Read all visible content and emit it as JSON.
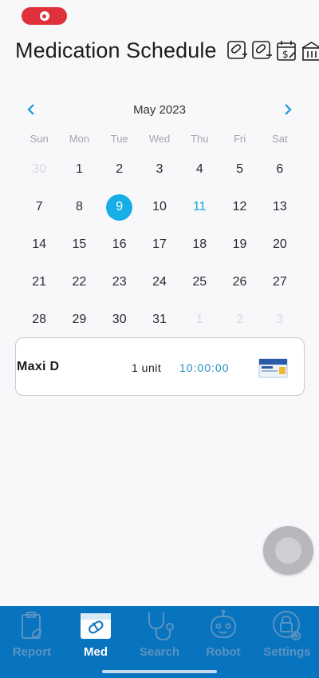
{
  "header": {
    "title": "Medication Schedule",
    "icons": [
      "add-medication-icon",
      "remove-medication-icon",
      "billing-calendar-icon",
      "pharmacy-icon"
    ]
  },
  "calendar": {
    "month_label": "May 2023",
    "weekdays": [
      "Sun",
      "Mon",
      "Tue",
      "Wed",
      "Thu",
      "Fri",
      "Sat"
    ],
    "days": [
      {
        "label": "30",
        "state": "muted"
      },
      {
        "label": "1",
        "state": ""
      },
      {
        "label": "2",
        "state": ""
      },
      {
        "label": "3",
        "state": ""
      },
      {
        "label": "4",
        "state": ""
      },
      {
        "label": "5",
        "state": ""
      },
      {
        "label": "6",
        "state": ""
      },
      {
        "label": "7",
        "state": ""
      },
      {
        "label": "8",
        "state": ""
      },
      {
        "label": "9",
        "state": "selected"
      },
      {
        "label": "10",
        "state": ""
      },
      {
        "label": "11",
        "state": "today"
      },
      {
        "label": "12",
        "state": ""
      },
      {
        "label": "13",
        "state": ""
      },
      {
        "label": "14",
        "state": ""
      },
      {
        "label": "15",
        "state": ""
      },
      {
        "label": "16",
        "state": ""
      },
      {
        "label": "17",
        "state": ""
      },
      {
        "label": "18",
        "state": ""
      },
      {
        "label": "19",
        "state": ""
      },
      {
        "label": "20",
        "state": ""
      },
      {
        "label": "21",
        "state": ""
      },
      {
        "label": "22",
        "state": ""
      },
      {
        "label": "23",
        "state": ""
      },
      {
        "label": "24",
        "state": ""
      },
      {
        "label": "25",
        "state": ""
      },
      {
        "label": "26",
        "state": ""
      },
      {
        "label": "27",
        "state": ""
      },
      {
        "label": "28",
        "state": ""
      },
      {
        "label": "29",
        "state": ""
      },
      {
        "label": "30",
        "state": ""
      },
      {
        "label": "31",
        "state": ""
      },
      {
        "label": "1",
        "state": "muted"
      },
      {
        "label": "2",
        "state": "muted"
      },
      {
        "label": "3",
        "state": "muted"
      }
    ],
    "selected_color": "#17aee8",
    "today_color": "#16a6dd"
  },
  "medications": [
    {
      "name": "Maxi D",
      "dose": "1 unit",
      "time": "10:00:00"
    }
  ],
  "bottom_nav": {
    "tabs": [
      {
        "label": "Report",
        "icon": "report-clipboard-icon",
        "active": false
      },
      {
        "label": "Med",
        "icon": "medication-calendar-icon",
        "active": true
      },
      {
        "label": "Search",
        "icon": "stethoscope-icon",
        "active": false
      },
      {
        "label": "Robot",
        "icon": "robot-icon",
        "active": false
      },
      {
        "label": "Settings",
        "icon": "lock-settings-icon",
        "active": false
      }
    ],
    "background": "#0873bf"
  }
}
